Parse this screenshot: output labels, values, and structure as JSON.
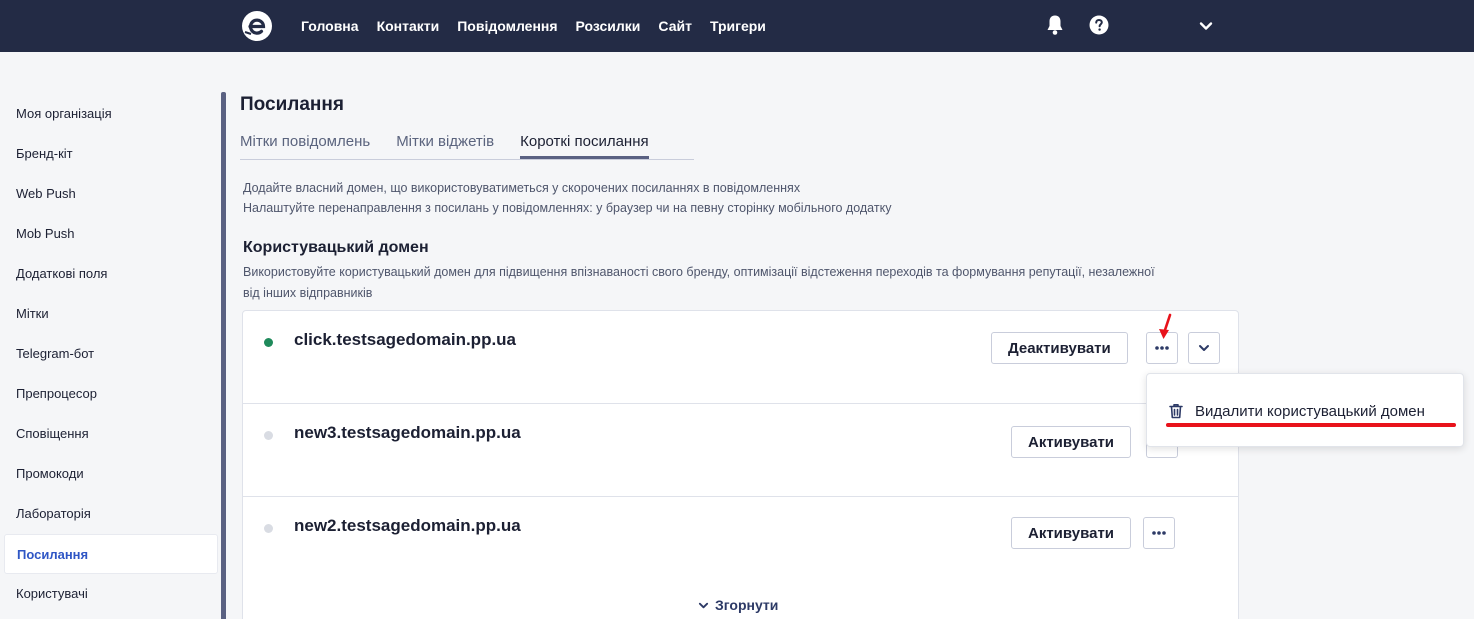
{
  "header": {
    "nav": [
      "Головна",
      "Контакти",
      "Повідомлення",
      "Розсилки",
      "Сайт",
      "Тригери"
    ],
    "icons": [
      "logo-icon",
      "bell-icon",
      "help-icon",
      "chevron-down-icon"
    ]
  },
  "sidebar": {
    "items": [
      {
        "label": "Моя організація"
      },
      {
        "label": "Бренд-кіт"
      },
      {
        "label": "Web Push"
      },
      {
        "label": "Mob Push"
      },
      {
        "label": "Додаткові поля"
      },
      {
        "label": "Мітки"
      },
      {
        "label": "Telegram-бот"
      },
      {
        "label": "Препроцесор"
      },
      {
        "label": "Сповіщення"
      },
      {
        "label": "Промокоди"
      },
      {
        "label": "Лабораторія"
      },
      {
        "label": "Посилання",
        "active": true
      },
      {
        "label": "Користувачі"
      }
    ]
  },
  "main": {
    "title": "Посилання",
    "tabs": [
      {
        "label": "Мітки повідомлень"
      },
      {
        "label": "Мітки віджетів"
      },
      {
        "label": "Короткі посилання",
        "active": true
      }
    ],
    "description_line1": "Додайте власний домен, що використовуватиметься у скорочених посиланнях в повідомленнях",
    "description_line2": "Налаштуйте перенаправлення з посилань у повідомленнях: у браузер чи на певну сторінку мобільного додатку",
    "section_title": "Користувацький домен",
    "section_desc_line1": "Використовуйте користувацький домен для підвищення впізнаваності свого бренду, оптимізації відстеження переходів та формування репутації, незалежної",
    "section_desc_line2": "від інших відправників",
    "domains": [
      {
        "name": "click.testsagedomain.pp.ua",
        "status": "active",
        "status_color": "#1f8a5b",
        "action_label": "Деактивувати"
      },
      {
        "name": "new3.testsagedomain.pp.ua",
        "status": "inactive",
        "status_color": "#d9dce3",
        "action_label": "Активувати"
      },
      {
        "name": "new2.testsagedomain.pp.ua",
        "status": "inactive",
        "status_color": "#d9dce3",
        "action_label": "Активувати"
      }
    ],
    "collapse_label": "Згорнути"
  },
  "dropdown": {
    "item_label": "Видалити користувацький домен",
    "item_icon": "trash-icon"
  },
  "colors": {
    "topbar": "#232b45",
    "active_link": "#2f56c5",
    "annotation": "#e8121b"
  }
}
